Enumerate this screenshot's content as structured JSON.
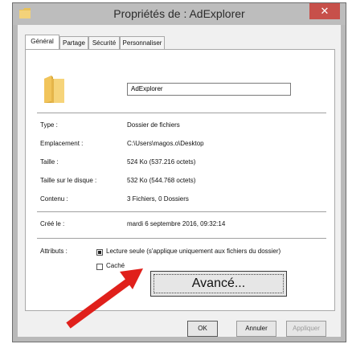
{
  "window": {
    "title": "Propriétés de : AdExplorer",
    "close_glyph": "✕"
  },
  "tabs": [
    {
      "label": "Général",
      "active": true
    },
    {
      "label": "Partage",
      "active": false
    },
    {
      "label": "Sécurité",
      "active": false
    },
    {
      "label": "Personnaliser",
      "active": false
    }
  ],
  "folder": {
    "name": "AdExplorer",
    "icon": "folder-icon"
  },
  "properties": [
    {
      "label": "Type :",
      "value": "Dossier de fichiers"
    },
    {
      "label": "Emplacement :",
      "value": "C:\\Users\\magos.o\\Desktop"
    },
    {
      "label": "Taille :",
      "value": "524 Ko (537.216 octets)"
    },
    {
      "label": "Taille sur le disque :",
      "value": "532 Ko (544.768 octets)"
    },
    {
      "label": "Contenu :",
      "value": "3 Fichiers, 0 Dossiers"
    }
  ],
  "created": {
    "label": "Créé le :",
    "value": "mardi 6 septembre 2016, 09:32:14"
  },
  "attributes": {
    "label": "Attributs :",
    "readonly": {
      "label": "Lecture seule (s'applique uniquement aux fichiers du dossier)",
      "checked": "indeterminate"
    },
    "hidden": {
      "label": "Caché",
      "checked": false
    }
  },
  "advanced_button": "Avancé...",
  "footer": {
    "ok": "OK",
    "cancel": "Annuler",
    "apply": "Appliquer"
  },
  "annotation": {
    "arrow_color": "#e0201b",
    "arrow_icon": "red-arrow-icon"
  }
}
